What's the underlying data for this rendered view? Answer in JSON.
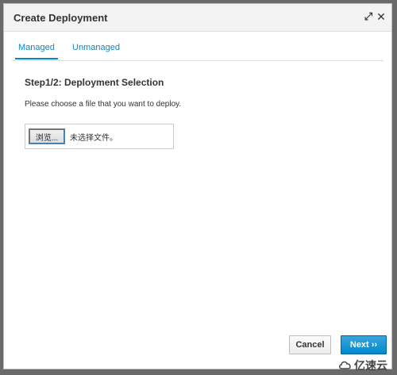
{
  "dialog": {
    "title": "Create Deployment",
    "maximize_icon": "expand-icon",
    "close_icon": "close-icon"
  },
  "tabs": [
    {
      "label": "Managed",
      "active": true
    },
    {
      "label": "Unmanaged",
      "active": false
    }
  ],
  "step": {
    "title": "Step1/2: Deployment Selection",
    "instruction": "Please choose a file that you want to deploy."
  },
  "file_input": {
    "button_label": "浏览...",
    "status": "未选择文件。"
  },
  "footer": {
    "cancel_label": "Cancel",
    "next_label": "Next ››"
  },
  "watermark": {
    "text": "亿速云"
  },
  "colors": {
    "accent": "#0088ce",
    "primary_button": "#0088ce"
  }
}
